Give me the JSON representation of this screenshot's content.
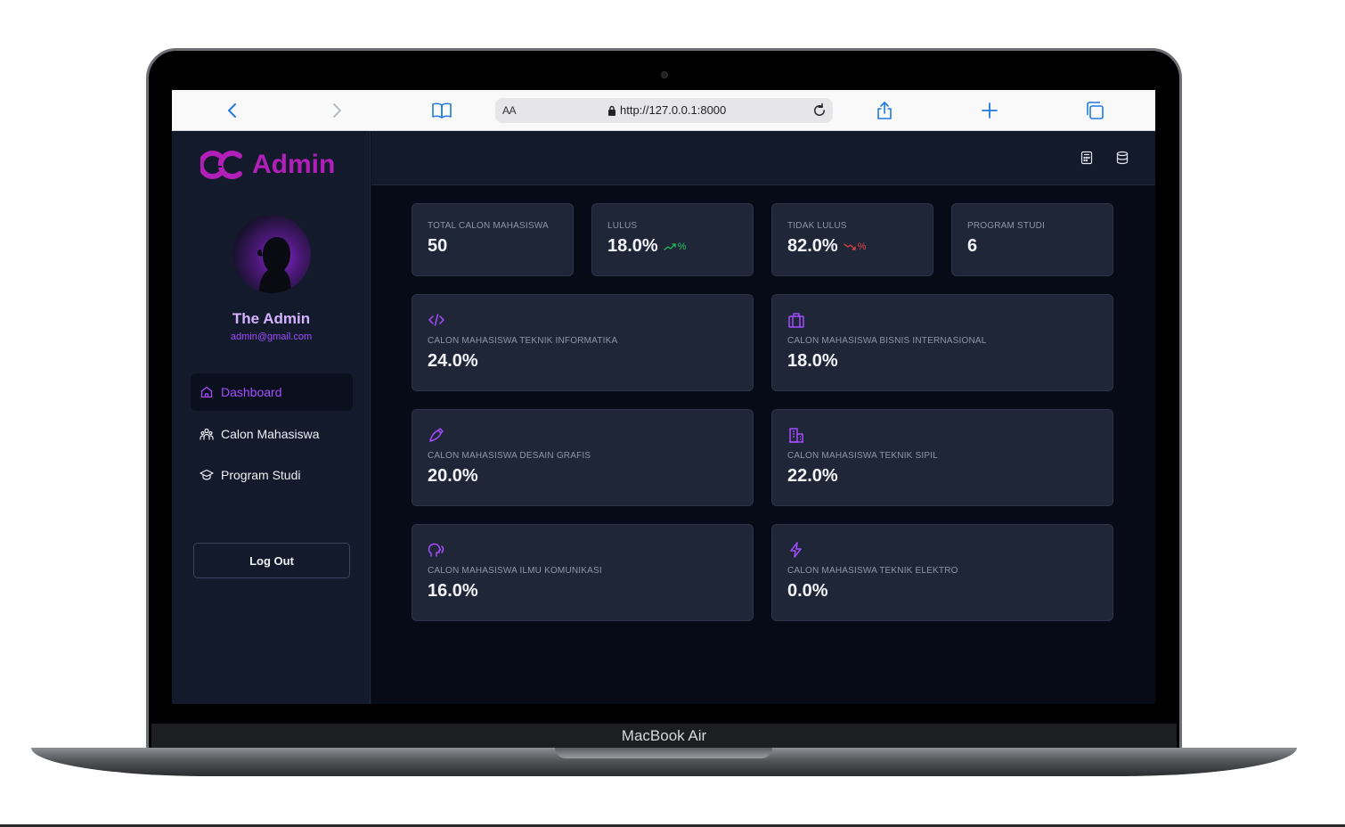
{
  "device": {
    "label": "MacBook Air"
  },
  "browser": {
    "url": "http://127.0.0.1:8000",
    "text_size_label": "AA"
  },
  "brand": {
    "name": "Admin",
    "color": "#b21fb8"
  },
  "user": {
    "name": "The Admin",
    "email": "admin@gmail.com"
  },
  "nav": {
    "items": [
      {
        "label": "Dashboard",
        "icon": "home-icon",
        "active": true
      },
      {
        "label": "Calon Mahasiswa",
        "icon": "users-icon",
        "active": false
      },
      {
        "label": "Program Studi",
        "icon": "graduation-cap-icon",
        "active": false
      }
    ],
    "logout_label": "Log Out"
  },
  "header": {
    "icons": [
      "calculator-icon",
      "database-icon"
    ]
  },
  "stats": [
    {
      "label": "TOTAL CALON MAHASISWA",
      "value": "50"
    },
    {
      "label": "LULUS",
      "value": "18.0%",
      "trend": "%",
      "trend_direction": "up"
    },
    {
      "label": "TIDAK LULUS",
      "value": "82.0%",
      "trend": "%",
      "trend_direction": "down"
    },
    {
      "label": "PROGRAM STUDI",
      "value": "6"
    }
  ],
  "programs": [
    {
      "label": "CALON MAHASISWA TEKNIK INFORMATIKA",
      "value": "24.0%",
      "icon": "code-icon"
    },
    {
      "label": "CALON MAHASISWA BISNIS INTERNASIONAL",
      "value": "18.0%",
      "icon": "briefcase-icon"
    },
    {
      "label": "CALON MAHASISWA DESAIN GRAFIS",
      "value": "20.0%",
      "icon": "brush-icon"
    },
    {
      "label": "CALON MAHASISWA TEKNIK SIPIL",
      "value": "22.0%",
      "icon": "building-icon"
    },
    {
      "label": "CALON MAHASISWA ILMU KOMUNIKASI",
      "value": "16.0%",
      "icon": "speaking-head-icon"
    },
    {
      "label": "CALON MAHASISWA TEKNIK ELEKTRO",
      "value": "0.0%",
      "icon": "bolt-icon"
    }
  ],
  "colors": {
    "accent": "#a64dff",
    "trend_up": "#22c55e",
    "trend_down": "#ef4444",
    "card_bg": "#1e2637",
    "page_bg": "#070b18"
  }
}
